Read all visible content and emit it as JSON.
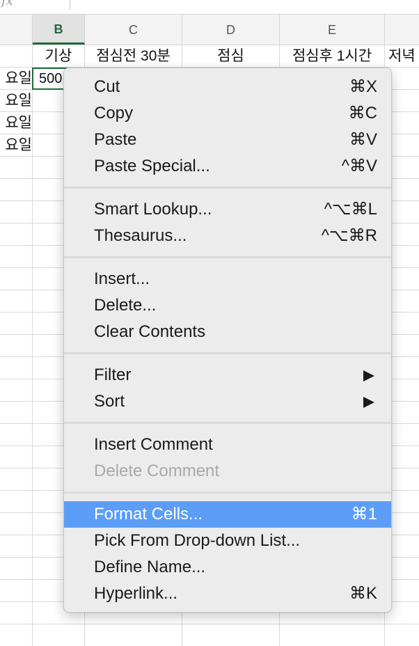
{
  "formula_bar": {
    "fx_label": "fx"
  },
  "columns": [
    {
      "letter": "B",
      "active": true
    },
    {
      "letter": "C"
    },
    {
      "letter": "D"
    },
    {
      "letter": "E"
    }
  ],
  "row_headers_row": {
    "b": "기상",
    "c": "점심전 30분",
    "d": "점심",
    "e": "점심후 1시간",
    "f": "저녁"
  },
  "left_cells": [
    "요일",
    "요일",
    "요일",
    "요일"
  ],
  "active_cell_value": "500",
  "context_menu": {
    "groups": [
      [
        {
          "label": "Cut",
          "shortcut": "⌘X"
        },
        {
          "label": "Copy",
          "shortcut": "⌘C"
        },
        {
          "label": "Paste",
          "shortcut": "⌘V"
        },
        {
          "label": "Paste Special...",
          "shortcut": "^⌘V"
        }
      ],
      [
        {
          "label": "Smart Lookup...",
          "shortcut": "^⌥⌘L"
        },
        {
          "label": "Thesaurus...",
          "shortcut": "^⌥⌘R"
        }
      ],
      [
        {
          "label": "Insert..."
        },
        {
          "label": "Delete..."
        },
        {
          "label": "Clear Contents"
        }
      ],
      [
        {
          "label": "Filter",
          "submenu": true
        },
        {
          "label": "Sort",
          "submenu": true
        }
      ],
      [
        {
          "label": "Insert Comment"
        },
        {
          "label": "Delete Comment",
          "disabled": true
        }
      ],
      [
        {
          "label": "Format Cells...",
          "shortcut": "⌘1",
          "highlighted": true
        },
        {
          "label": "Pick From Drop-down List..."
        },
        {
          "label": "Define Name..."
        },
        {
          "label": "Hyperlink...",
          "shortcut": "⌘K"
        }
      ]
    ]
  },
  "colors": {
    "accent_green": "#1f6b3c",
    "highlight_blue": "#5c9df7",
    "menu_bg": "#ececec"
  }
}
